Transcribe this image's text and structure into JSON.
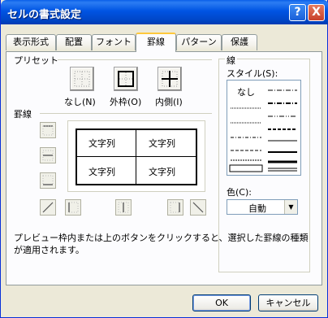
{
  "window": {
    "title": "セルの書式設定",
    "help_glyph": "?",
    "close_glyph": "X"
  },
  "tabs": [
    {
      "label": "表示形式",
      "active": false
    },
    {
      "label": "配置",
      "active": false
    },
    {
      "label": "フォント",
      "active": false
    },
    {
      "label": "罫線",
      "active": true
    },
    {
      "label": "パターン",
      "active": false
    },
    {
      "label": "保護",
      "active": false
    }
  ],
  "presets": {
    "heading": "プリセット",
    "none_label": "なし(N)",
    "outline_label": "外枠(O)",
    "inside_label": "内側(I)"
  },
  "border": {
    "heading": "罫線",
    "preview_cells": [
      "文字列",
      "文字列",
      "文字列",
      "文字列"
    ]
  },
  "line": {
    "heading": "線",
    "style_label": "スタイル(S):",
    "none_style": "なし",
    "color_label": "色(C):",
    "color_value": "自動"
  },
  "description": "プレビュー枠内または上のボタンをクリックすると、選択した罫線の種類が適用されます。",
  "buttons": {
    "ok": "OK",
    "cancel": "キャンセル"
  }
}
